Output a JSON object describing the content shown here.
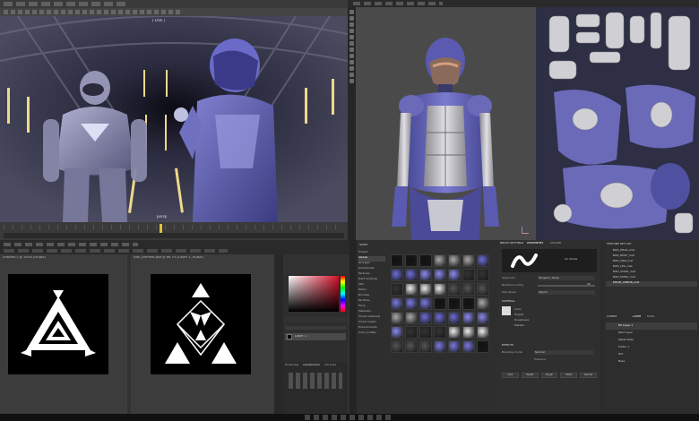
{
  "maya": {
    "viewport_hud_top": "[ LIVE ]",
    "viewport_camera_label": "persp",
    "timeline_frame": "1"
  },
  "substance": {
    "tools": [
      "paint",
      "erase",
      "smudge",
      "clone",
      "fill",
      "picker",
      "select",
      "transform",
      "project",
      "polyfill",
      "ruler",
      "bake"
    ]
  },
  "photoshop": {
    "tab_1": "Untitled-1 @ 100% (RGB/8)",
    "tab_2": "Icon_Element.psd @ 66.7% (Layer 1, RGB/8)",
    "swatch_accent": "#c7203a",
    "panel_tabs": [
      "Properties",
      "Adjustments",
      "Libraries"
    ],
    "layer_name": "Layer 1"
  },
  "shelf": {
    "title": "Shelf",
    "categories": [
      "Project",
      "Alphas",
      "Grunges",
      "Procedurals",
      "Textures",
      "Hard Surfaces",
      "Skin",
      "Filters",
      "Brushes",
      "Particles",
      "Tools",
      "Materials",
      "Smart materials",
      "Smart masks",
      "Environments",
      "Color profiles"
    ]
  },
  "properties": {
    "tabs": [
      "BRUSH SETTINGS",
      "PROPERTIES",
      "SHADER"
    ],
    "brush_name": "Air stroke",
    "rows": [
      {
        "label": "Alignment",
        "value": "Tangent | Wrap"
      },
      {
        "label": "Backface culling",
        "value": "90"
      },
      {
        "label": "Size Space",
        "value": "Object"
      }
    ],
    "material_label": "MATERIAL",
    "channels": [
      "Color",
      "Height",
      "Roughness",
      "Metallic"
    ],
    "effects_title": "EFFECTS",
    "blend_label": "Blending mode",
    "blend_value": "Normal",
    "pressure_label": "Pressure",
    "buttons": [
      "Color",
      "Height",
      "Rough",
      "Metal",
      "Normal"
    ]
  },
  "texture_set": {
    "title": "TEXTURE SET LIST",
    "items": [
      "BOD_HEAD_mat",
      "BOD_BODY_mat",
      "BOD_ARM_mat",
      "BOD_LEG_mat",
      "BOD_VISOR_mat",
      "BOD_EMISS_mat",
      "EQUIP_ARMOR_mat"
    ],
    "layers_title": "LAYERS",
    "layer_tabs": [
      "LAYER",
      "MASK"
    ],
    "layers": [
      "Fill Layer 1",
      "Paint layer",
      "Metal Plate",
      "Folder 1",
      "Dirt",
      "Base"
    ]
  },
  "colors": {
    "ui_bg": "#2b2b2b",
    "accent_blue": "#6c6cd8",
    "suit_purple": "#5a5ab0"
  }
}
